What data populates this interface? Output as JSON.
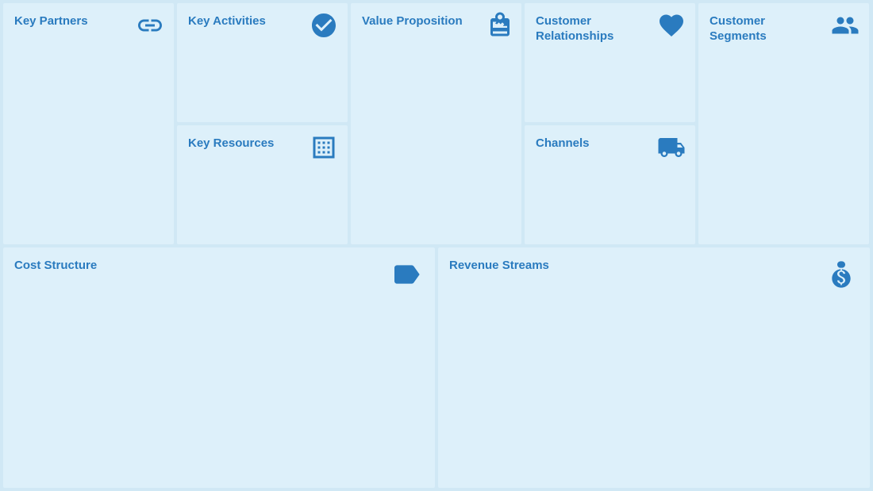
{
  "cells": {
    "key_partners": {
      "title": "Key Partners",
      "icon": "link"
    },
    "key_activities": {
      "title": "Key Activities",
      "icon": "check"
    },
    "key_resources": {
      "title": "Key Resources",
      "icon": "factory"
    },
    "value_proposition": {
      "title": "Value Proposition",
      "icon": "gift"
    },
    "customer_relationships": {
      "title": "Customer Relationships",
      "icon": "heart"
    },
    "channels": {
      "title": "Channels",
      "icon": "truck"
    },
    "customer_segments": {
      "title": "Customer Segments",
      "icon": "people"
    },
    "cost_structure": {
      "title": "Cost Structure",
      "icon": "tag"
    },
    "revenue_streams": {
      "title": "Revenue Streams",
      "icon": "moneybag"
    }
  }
}
